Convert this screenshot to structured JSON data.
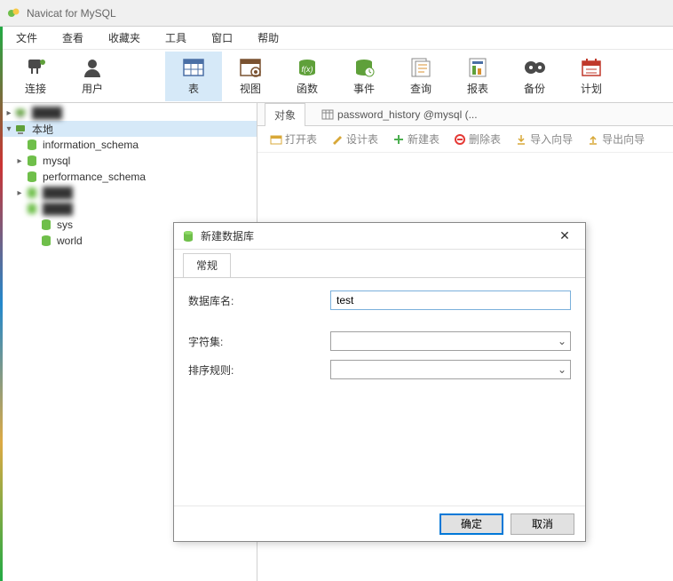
{
  "app": {
    "title": "Navicat for MySQL"
  },
  "menu": [
    "文件",
    "查看",
    "收藏夹",
    "工具",
    "窗口",
    "帮助"
  ],
  "toolbar": [
    {
      "id": "connect",
      "label": "连接",
      "icon": "plug"
    },
    {
      "id": "user",
      "label": "用户",
      "icon": "user"
    },
    {
      "id": "spacer"
    },
    {
      "id": "table",
      "label": "表",
      "icon": "table",
      "active": true
    },
    {
      "id": "view",
      "label": "视图",
      "icon": "view"
    },
    {
      "id": "func",
      "label": "函数",
      "icon": "func"
    },
    {
      "id": "event",
      "label": "事件",
      "icon": "event"
    },
    {
      "id": "query",
      "label": "查询",
      "icon": "query"
    },
    {
      "id": "report",
      "label": "报表",
      "icon": "report"
    },
    {
      "id": "backup",
      "label": "备份",
      "icon": "backup"
    },
    {
      "id": "schedule",
      "label": "计划",
      "icon": "schedule"
    }
  ],
  "tree": [
    {
      "level": 0,
      "expand": "▸",
      "icon": "conn",
      "name": "",
      "blur": true
    },
    {
      "level": 0,
      "expand": "▾",
      "icon": "conn",
      "name": "本地",
      "selected": true
    },
    {
      "level": 1,
      "expand": "",
      "icon": "db",
      "name": "information_schema"
    },
    {
      "level": 1,
      "expand": "▸",
      "icon": "db",
      "name": "mysql"
    },
    {
      "level": 1,
      "expand": "",
      "icon": "db",
      "name": "performance_schema"
    },
    {
      "level": 1,
      "expand": "▸",
      "icon": "db",
      "name": "",
      "blur": true
    },
    {
      "level": 1,
      "expand": "",
      "icon": "db",
      "name": "",
      "blur": true
    },
    {
      "level": 2,
      "expand": "",
      "icon": "db",
      "name": "sys"
    },
    {
      "level": 2,
      "expand": "",
      "icon": "db",
      "name": "world"
    }
  ],
  "contentTabs": [
    {
      "label": "对象",
      "active": true
    },
    {
      "label": "password_history @mysql (...",
      "icon": "table"
    }
  ],
  "subtoolbar": {
    "open": "打开表",
    "design": "设计表",
    "new": "新建表",
    "delete": "删除表",
    "import": "导入向导",
    "export": "导出向导"
  },
  "dialog": {
    "title": "新建数据库",
    "tab": "常规",
    "fields": {
      "dbname_label": "数据库名:",
      "dbname_value": "test",
      "charset_label": "字符集:",
      "collation_label": "排序规则:"
    },
    "ok": "确定",
    "cancel": "取消"
  }
}
